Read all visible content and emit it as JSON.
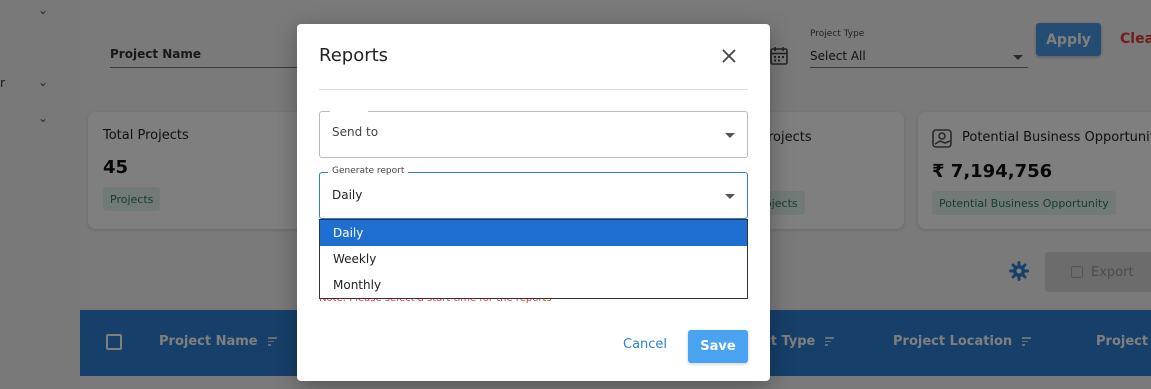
{
  "filters": {
    "project_name_label": "Project Name",
    "project_type_label": "Project Type",
    "project_type_value": "Select All",
    "apply_label": "Apply",
    "clear_label": "Clear",
    "sidebar_fragment": "r"
  },
  "cards": [
    {
      "title": "Total Projects",
      "value": "45",
      "tag": "Projects"
    },
    {
      "title": "rojects",
      "tag": "ojects"
    },
    {
      "title": "Potential Business Opportunity",
      "value": "₹ 7,194,756",
      "tag": "Potential Business Opportunity"
    }
  ],
  "toolbar": {
    "export_label": "Export"
  },
  "table": {
    "headers": [
      "Project Name",
      "ct Type",
      "Project Location",
      "Project A"
    ]
  },
  "modal": {
    "title": "Reports",
    "send_to_label": "Send to",
    "generate_report_label": "Generate report",
    "generate_report_value": "Daily",
    "note": "Note: Please select a start time for the reports",
    "cancel_label": "Cancel",
    "save_label": "Save"
  },
  "dropdown": {
    "options": [
      "Daily",
      "Weekly",
      "Monthly"
    ],
    "selected": "Daily"
  },
  "colors": {
    "primary": "#2d7fd3",
    "selected_option": "#1f6fd2",
    "danger": "#e53935",
    "tag_bg": "#e4f4f0"
  }
}
